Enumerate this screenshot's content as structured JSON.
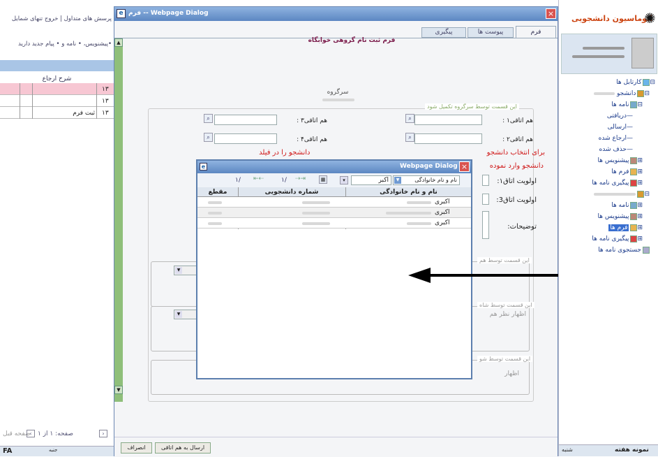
{
  "left": {
    "links": "پرسش های متداول | خروج",
    "links_prefix": "تنهای شمایل",
    "notice": "•پیشنویس، • نامه و • پیام جدید دارید",
    "col_header": "شرح ارجاع",
    "rows": [
      {
        "num": "۱۳",
        "text": ""
      },
      {
        "num": "۱۳",
        "text": ""
      },
      {
        "num": "۱۳",
        "text": "ثبت فرم"
      }
    ],
    "pager": "صفحه: ۱ از ۱",
    "prev": "صفحه قبل",
    "lang": "FA",
    "foot": "جنبه"
  },
  "dlg": {
    "title": "فرم -- Webpage Dialog",
    "tabs": [
      "فرم",
      "پیوست ها",
      "پیگیری"
    ],
    "heading": "فرم ثبت نام گروهی خوابگاه",
    "leader": "سرگروه",
    "sec1": "این قسمت توسط سرگروه تکمیل شود",
    "rm1": "هم اتاقی۱ :",
    "rm2": "هم اتاقی۲ :",
    "rm3": "هم اتاقی۳ :",
    "rm4": "هم اتاقی۴ :",
    "warn1": "برای انتخاب دانشجو",
    "warn1b": "دانشجو را در فیلد",
    "warn2": "دانشجو وارد نموده",
    "p1": "اولویت اتاق۱:",
    "p3": "اولویت اتاق3:",
    "desc": "توضیحات:",
    "sec2": "این قسمت توسط هم",
    "sec3": "این قسمت توسط شاه",
    "opinion": "اظهار نظر هم",
    "sec4": "این قسمت توسط شو",
    "opinion2": "اظهار",
    "send": "ارسال به هم اتاقی",
    "cancel": "انصراف"
  },
  "inner": {
    "title": "Webpage Dialog --",
    "pager_a": "۱/",
    "pager_b": "۱/",
    "search_field": "نام و نام خانوادگی",
    "search_val": "اکبر",
    "cols": [
      "نام و نام خانوادگی",
      "شماره دانشجویی",
      "مقطع"
    ],
    "rows": [
      {
        "name": "اکبری"
      },
      {
        "name": "اکبری"
      },
      {
        "name": "اکبری"
      }
    ]
  },
  "right": {
    "logo": "اتوماسیون دانشجویی",
    "tree": [
      "کارتابل ها",
      "دانشجو",
      "نامه ها",
      "دریافتی",
      "ارسالی",
      "ارجاع شده",
      "حذف شده",
      "پیشنویس ها",
      "فرم ها",
      "پیگیری نامه ها",
      "نامه ها",
      "پیشنویس ها",
      "فرم ها",
      "پیگیری نامه ها",
      "جستجوی نامه ها"
    ],
    "foot_left": "شنبه",
    "foot_right": "نمونه هفته"
  },
  "colors": {
    "arrow": "#000000",
    "titlebar": "#6f9ad2",
    "close": "#d9534f",
    "tree_blue": "#1a3a8a"
  }
}
